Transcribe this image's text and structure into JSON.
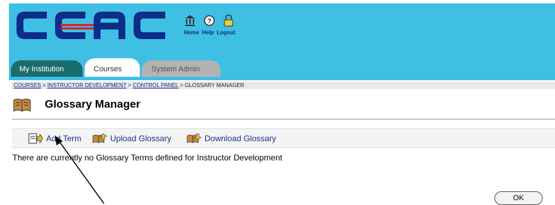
{
  "header": {
    "logo_text": "CCAC",
    "brand_colors": {
      "banner": "#3fbfe3",
      "logo_blue": "#0c2d8a",
      "logo_red": "#d8202a"
    },
    "links": [
      "Home",
      "Help",
      "Logout"
    ],
    "icons": [
      "institution-icon",
      "help-icon",
      "logout-icon"
    ]
  },
  "tabs": [
    {
      "label": "My Institution",
      "active": false
    },
    {
      "label": "Courses",
      "active": true
    },
    {
      "label": "System Admin",
      "active": false
    }
  ],
  "breadcrumb": {
    "items": [
      "COURSES",
      "INSTRUCTOR DEVELOPMENT",
      "CONTROL PANEL",
      "GLOSSARY MANAGER"
    ],
    "separator": ">"
  },
  "page": {
    "title": "Glossary Manager",
    "title_icon": "book-icon"
  },
  "actions": [
    {
      "label": "Add Term",
      "icon": "add-term-icon"
    },
    {
      "label": "Upload Glossary",
      "icon": "upload-book-icon"
    },
    {
      "label": "Download Glossary",
      "icon": "download-book-icon"
    }
  ],
  "message": "There are currently no Glossary Terms defined for Instructor Development",
  "ok_button": "OK"
}
